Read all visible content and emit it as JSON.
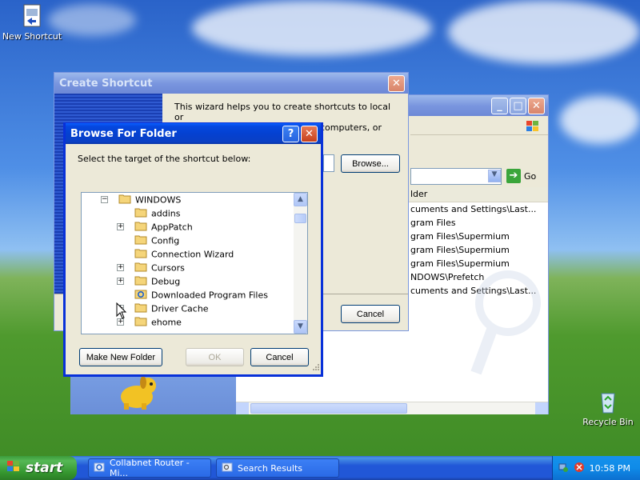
{
  "desktop": {
    "icons": [
      {
        "label": "New Shortcut"
      },
      {
        "label": "Recycle Bin"
      }
    ]
  },
  "search_window": {
    "address_go": "Go",
    "column_header": "In Folder",
    "results": [
      "C:\\Documents and Settings\\Last...",
      "C:\\Program Files",
      "C:\\Program Files\\Supermium",
      "C:\\Program Files\\Supermium",
      "C:\\Program Files\\Supermium",
      "C:\\WINDOWS\\Prefetch",
      "C:\\Documents and Settings\\Last..."
    ],
    "visible_results": [
      "cuments and Settings\\Last...",
      "gram Files",
      "gram Files\\Supermium",
      "gram Files\\Supermium",
      "gram Files\\Supermium",
      "NDOWS\\Prefetch",
      "cuments and Settings\\Last..."
    ],
    "visible_header": "lder"
  },
  "create_shortcut": {
    "title": "Create Shortcut",
    "description": "This wizard helps you to create shortcuts to local or network programs, files, folders, computers, or Internet",
    "description_lines": [
      "This wizard helps you to create shortcuts to local or",
      "network programs, files, folders, computers, or Internet"
    ],
    "browse_label": "Browse...",
    "cancel_label": "Cancel"
  },
  "browse_dialog": {
    "title": "Browse For Folder",
    "help_label": "?",
    "prompt": "Select the target of the shortcut below:",
    "tree": [
      {
        "label": "WINDOWS",
        "indent": 0,
        "expander": "minus",
        "icon": "folder-open-icon"
      },
      {
        "label": "addins",
        "indent": 1,
        "expander": "",
        "icon": "folder-icon"
      },
      {
        "label": "AppPatch",
        "indent": 1,
        "expander": "plus",
        "icon": "folder-icon"
      },
      {
        "label": "Config",
        "indent": 1,
        "expander": "",
        "icon": "folder-icon"
      },
      {
        "label": "Connection Wizard",
        "indent": 1,
        "expander": "",
        "icon": "folder-icon"
      },
      {
        "label": "Cursors",
        "indent": 1,
        "expander": "plus",
        "icon": "folder-icon"
      },
      {
        "label": "Debug",
        "indent": 1,
        "expander": "plus",
        "icon": "folder-icon"
      },
      {
        "label": "Downloaded Program Files",
        "indent": 1,
        "expander": "",
        "icon": "ie-folder-icon"
      },
      {
        "label": "Driver Cache",
        "indent": 1,
        "expander": "plus",
        "icon": "folder-icon"
      },
      {
        "label": "ehome",
        "indent": 1,
        "expander": "plus",
        "icon": "folder-icon"
      }
    ],
    "new_folder_label": "Make New Folder",
    "ok_label": "OK",
    "cancel_label": "Cancel"
  },
  "taskbar": {
    "start_label": "start",
    "tasks": [
      {
        "label": "Collabnet Router - Mi..."
      },
      {
        "label": "Search Results"
      }
    ],
    "clock": "10:58 PM"
  }
}
